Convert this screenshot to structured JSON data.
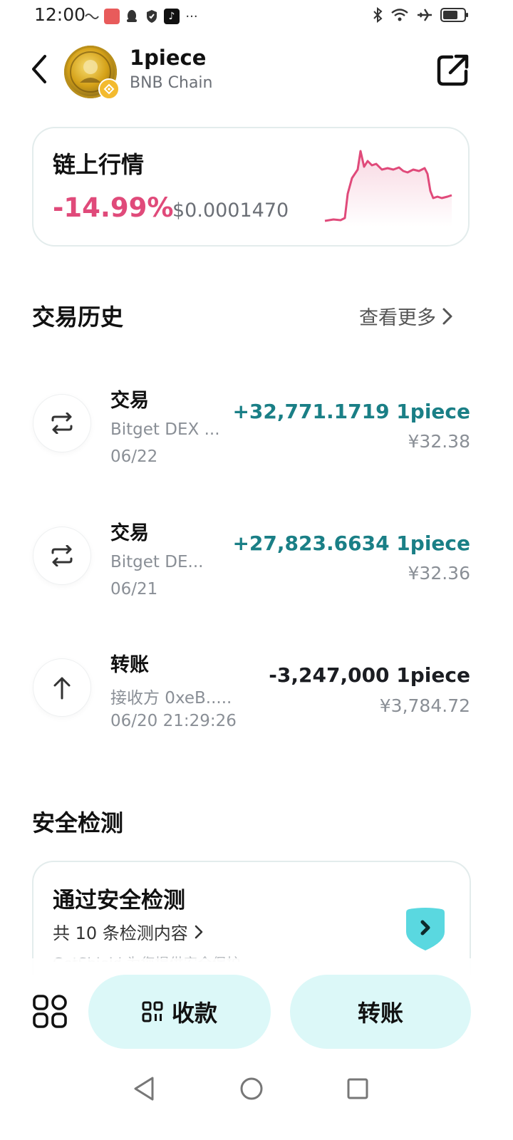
{
  "status_bar": {
    "time": "12:00",
    "left_icons": [
      "link-icon",
      "app-icon",
      "qq-icon",
      "shield-icon",
      "tiktok-icon",
      "more-dots-icon"
    ],
    "right_icons": [
      "bluetooth-icon",
      "wifi-icon",
      "airplane-icon",
      "battery-icon"
    ]
  },
  "header": {
    "token_name": "1piece",
    "chain_name": "BNB Chain"
  },
  "market": {
    "title": "链上行情",
    "change": "-14.99%",
    "price": "$0.0001470",
    "sparkline_color": "#e04a7a"
  },
  "history": {
    "title": "交易历史",
    "see_more": "查看更多",
    "items": [
      {
        "icon": "swap-icon",
        "type": "交易",
        "sub": "Bitget DEX ...",
        "date": "06/22",
        "amount": "+32,771.1719 1piece",
        "fiat": "¥32.38",
        "positive": true
      },
      {
        "icon": "swap-icon",
        "type": "交易",
        "sub": "Bitget DE...",
        "date": "06/21",
        "amount": "+27,823.6634 1piece",
        "fiat": "¥32.36",
        "positive": true
      },
      {
        "icon": "arrow-up-icon",
        "type": "转账",
        "sub": "接收方 0xeB.....",
        "date": "06/20 21:29:26",
        "amount": "-3,247,000 1piece",
        "fiat": "¥3,784.72",
        "positive": false
      }
    ]
  },
  "security": {
    "section_title": "安全检测",
    "card_title": "通过安全检测",
    "card_sub": "共 10 条检测内容",
    "card_faint": "GetShield 为您提供安全保护"
  },
  "actions": {
    "receive": "收款",
    "transfer": "转账"
  },
  "colors": {
    "accent": "#1a7f86",
    "negative": "#e04a7a",
    "button_bg": "#dcf8f8",
    "shield": "#5ad8e0"
  }
}
